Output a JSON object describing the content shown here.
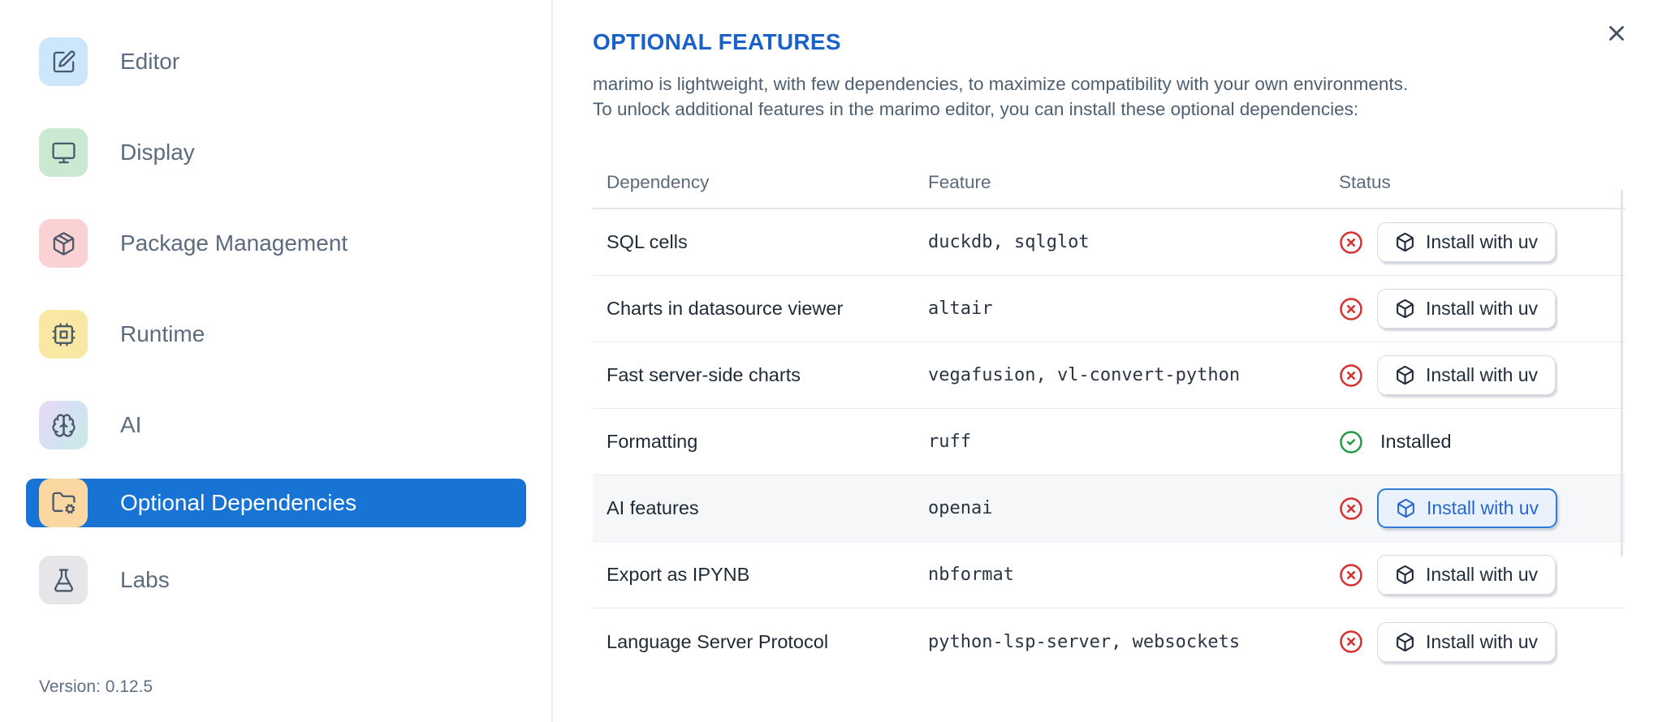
{
  "sidebar": {
    "items": [
      {
        "label": "Editor",
        "icon": "edit-icon",
        "selected": false
      },
      {
        "label": "Display",
        "icon": "monitor-icon",
        "selected": false
      },
      {
        "label": "Package Management",
        "icon": "package-icon",
        "selected": false
      },
      {
        "label": "Runtime",
        "icon": "cpu-icon",
        "selected": false
      },
      {
        "label": "AI",
        "icon": "brain-icon",
        "selected": false
      },
      {
        "label": "Optional Dependencies",
        "icon": "folder-cog-icon",
        "selected": true
      },
      {
        "label": "Labs",
        "icon": "flask-icon",
        "selected": false
      }
    ],
    "version": "Version: 0.12.5"
  },
  "dialog": {
    "title": "OPTIONAL FEATURES",
    "description_lines": [
      "marimo is lightweight, with few dependencies, to maximize compatibility with your own environments.",
      "To unlock additional features in the marimo editor, you can install these optional dependencies:"
    ],
    "close_icon": "close-icon"
  },
  "table": {
    "headers": [
      "Dependency",
      "Feature",
      "Status"
    ],
    "install_button_label": "Install with uv",
    "installed_label": "Installed",
    "rows": [
      {
        "dependency": "SQL cells",
        "feature": "duckdb, sqlglot",
        "installed": false,
        "highlighted": false
      },
      {
        "dependency": "Charts in datasource viewer",
        "feature": "altair",
        "installed": false,
        "highlighted": false
      },
      {
        "dependency": "Fast server-side charts",
        "feature": "vegafusion, vl-convert-python",
        "installed": false,
        "highlighted": false
      },
      {
        "dependency": "Formatting",
        "feature": "ruff",
        "installed": true,
        "highlighted": false
      },
      {
        "dependency": "AI features",
        "feature": "openai",
        "installed": false,
        "highlighted": true
      },
      {
        "dependency": "Export as IPYNB",
        "feature": "nbformat",
        "installed": false,
        "highlighted": false
      },
      {
        "dependency": "Language Server Protocol",
        "feature": "python-lsp-server, websockets",
        "installed": false,
        "highlighted": false
      }
    ]
  },
  "colors": {
    "accent_blue": "#1774d4",
    "title_blue": "#1a61c9",
    "status_red": "#d83030",
    "status_green": "#259a44",
    "row_highlight": "#f5f7f9",
    "focused_button_border": "#2e7cd6",
    "focused_button_bg": "#e9f1fd"
  }
}
